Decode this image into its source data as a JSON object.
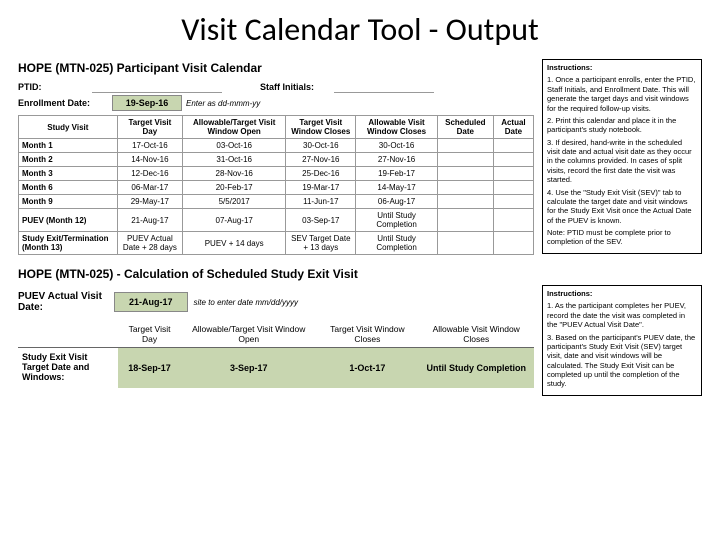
{
  "title": "Visit Calendar Tool - Output",
  "section1": {
    "report_title": "HOPE (MTN-025) Participant Visit Calendar",
    "ptid_label": "PTID:",
    "staff_label": "Staff Initials:",
    "enroll_label": "Enrollment Date:",
    "enroll_value": "19-Sep-16",
    "enroll_hint": "Enter as dd-mmm-yy",
    "instructions_title": "Instructions:",
    "instr": [
      "1. Once a participant enrolls, enter the PTID, Staff Initials, and Enrollment Date. This will generate the target days and visit windows for the required follow-up visits.",
      "2. Print this calendar and place it in the participant's study notebook.",
      "3. If desired, hand-write in the scheduled visit date and actual visit date as they occur in the columns provided. In cases of split visits, record the first date the visit was started.",
      "4. Use the \"Study Exit Visit (SEV)\" tab to calculate the target date and visit windows for the Study Exit Visit once the Actual Date of the PUEV is known.",
      "Note: PTID must be complete prior to completion of the SEV."
    ],
    "cols": [
      "Study Visit",
      "Target Visit Day",
      "Allowable/Target Visit Window Open",
      "Target Visit Window Closes",
      "Allowable Visit Window Closes",
      "Scheduled Date",
      "Actual Date"
    ],
    "rows": [
      [
        "Month 1",
        "17-Oct-16",
        "03-Oct-16",
        "30-Oct-16",
        "30-Oct-16",
        "",
        ""
      ],
      [
        "Month 2",
        "14-Nov-16",
        "31-Oct-16",
        "27-Nov-16",
        "27-Nov-16",
        "",
        ""
      ],
      [
        "Month 3",
        "12-Dec-16",
        "28-Nov-16",
        "25-Dec-16",
        "19-Feb-17",
        "",
        ""
      ],
      [
        "Month 6",
        "06-Mar-17",
        "20-Feb-17",
        "19-Mar-17",
        "14-May-17",
        "",
        ""
      ],
      [
        "Month 9",
        "29-May-17",
        "5/5/2017",
        "11-Jun-17",
        "06-Aug-17",
        "",
        ""
      ],
      [
        "PUEV (Month 12)",
        "21-Aug-17",
        "07-Aug-17",
        "03-Sep-17",
        "Until Study Completion",
        "",
        ""
      ],
      [
        "Study Exit/Termination (Month 13)",
        "PUEV Actual Date + 28 days",
        "PUEV + 14 days",
        "SEV Target Date + 13 days",
        "Until Study Completion",
        "",
        ""
      ]
    ]
  },
  "section2": {
    "report_title": "HOPE (MTN-025) - Calculation of Scheduled Study Exit Visit",
    "puev_label": "PUEV Actual Visit Date:",
    "puev_value": "21-Aug-17",
    "puev_hint": "site to enter date mm/dd/yyyy",
    "instructions_title": "Instructions:",
    "instr": [
      "1. As the participant completes her PUEV, record the date the visit was completed in the \"PUEV Actual Visit Date\".",
      "3. Based on the participant's PUEV date, the participant's Study Exit Visit (SEV) target visit, date and visit windows will be calculated. The Study Exit Visit can be completed up until the completion of the study."
    ],
    "exit_cols": [
      "",
      "Target Visit Day",
      "Allowable/Target Visit Window Open",
      "Target Visit Window Closes",
      "Allowable Visit Window Closes"
    ],
    "exit_label": "Study Exit Visit Target Date and Windows:",
    "exit_row": [
      "18-Sep-17",
      "3-Sep-17",
      "1-Oct-17",
      "Until Study Completion"
    ]
  }
}
